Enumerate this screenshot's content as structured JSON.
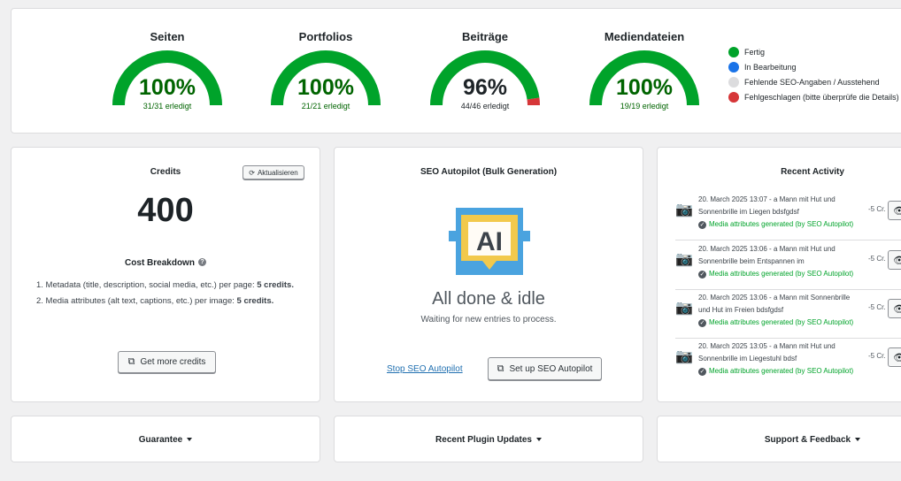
{
  "gauges": [
    {
      "title": "Seiten",
      "percent": "100%",
      "done": "31/31 erledigt",
      "fraction": 1.0,
      "failed_fraction": 0,
      "text_color": "#006400"
    },
    {
      "title": "Portfolios",
      "percent": "100%",
      "done": "21/21 erledigt",
      "fraction": 1.0,
      "failed_fraction": 0,
      "text_color": "#006400"
    },
    {
      "title": "Beiträge",
      "percent": "96%",
      "done": "44/46 erledigt",
      "fraction": 0.9565,
      "failed_fraction": 0.0435,
      "text_color": "#1d2327"
    },
    {
      "title": "Mediendateien",
      "percent": "100%",
      "done": "19/19 erledigt",
      "fraction": 1.0,
      "failed_fraction": 0,
      "text_color": "#006400"
    }
  ],
  "legend": [
    {
      "label": "Fertig",
      "color": "#00a32a"
    },
    {
      "label": "In Bearbeitung",
      "color": "#1a73e8"
    },
    {
      "label": "Fehlende SEO-Angaben / Ausstehend",
      "color": "#dcdcde"
    },
    {
      "label": "Fehlgeschlagen (bitte überprüfe die Details)",
      "color": "#d63638"
    }
  ],
  "credits": {
    "title": "Credits",
    "refresh_label": "Aktualisieren",
    "amount": "400",
    "cost_title": "Cost Breakdown",
    "cost_items": [
      {
        "text": "1. Metadata (title, description, social media, etc.) per page: ",
        "bold": "5 credits."
      },
      {
        "text": "2. Media attributes (alt text, captions, etc.) per image: ",
        "bold": "5 credits."
      }
    ],
    "get_more_label": "Get more credits"
  },
  "autopilot": {
    "title": "SEO Autopilot (Bulk Generation)",
    "logo_text": "AI",
    "status_title": "All done & idle",
    "status_sub": "Waiting for new entries to process.",
    "stop_label": "Stop SEO Autopilot",
    "setup_label": "Set up SEO Autopilot"
  },
  "activity": {
    "title": "Recent Activity",
    "items": [
      {
        "line1": "20. March 2025 13:07 - a Mann mit Hut und",
        "line2": "Sonnenbrille im Liegen bdsfgdsf",
        "status": "Media attributes generated (by SEO Autopilot)",
        "cost": "-5 Cr."
      },
      {
        "line1": "20. March 2025 13:06 - a Mann mit Hut und",
        "line2": "Sonnenbrille beim Entspannen im",
        "status": "Media attributes generated (by SEO Autopilot)",
        "cost": "-5 Cr."
      },
      {
        "line1": "20. March 2025 13:06 - a Mann mit Sonnenbrille",
        "line2": "und Hut im Freien bdsfgdsf",
        "status": "Media attributes generated (by SEO Autopilot)",
        "cost": "-5 Cr."
      },
      {
        "line1": "20. March 2025 13:05 - a Mann mit Hut und",
        "line2": "Sonnenbrille im Liegestuhl bdsf",
        "status": "Media attributes generated (by SEO Autopilot)",
        "cost": "-5 Cr."
      }
    ]
  },
  "bottom": {
    "guarantee": "Guarantee",
    "updates": "Recent Plugin Updates",
    "support": "Support & Feedback"
  },
  "colors": {
    "done": "#00a32a",
    "pending": "#dcdcde",
    "failed": "#d63638"
  }
}
